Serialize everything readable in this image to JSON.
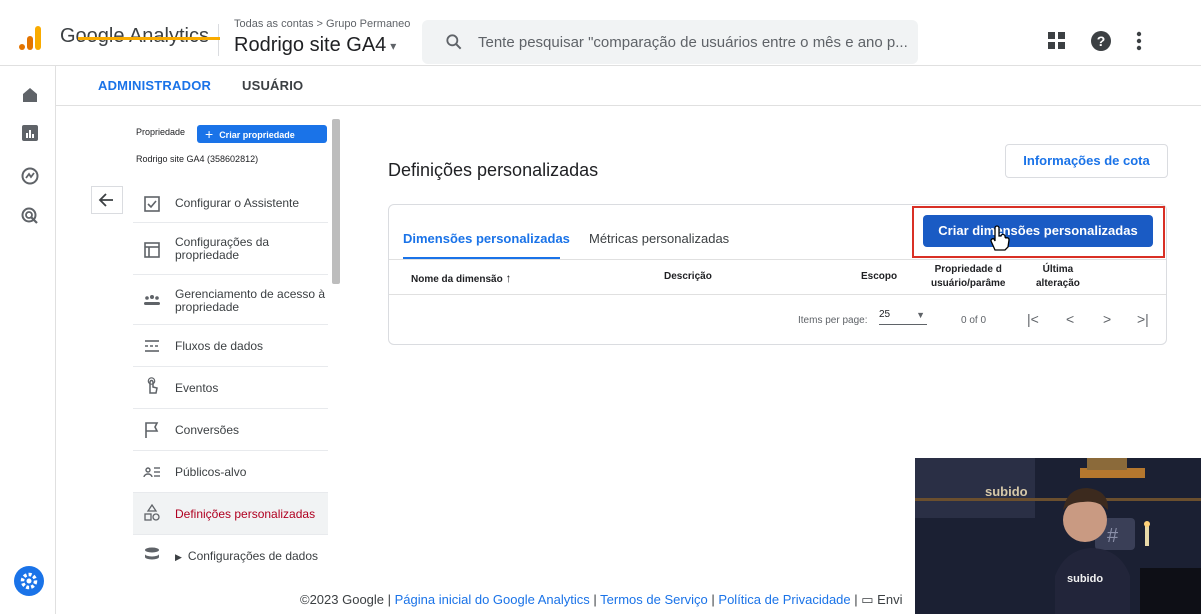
{
  "header": {
    "app_name": "Google Analytics",
    "account_breadcrumb": "Todas as contas > Grupo Permaneo",
    "property_name": "Rodrigo site GA4",
    "search_placeholder": "Tente pesquisar \"comparação de usuários entre o mês e ano p..."
  },
  "tabs": {
    "admin": "ADMINISTRADOR",
    "user": "USUÁRIO"
  },
  "admin_panel": {
    "property_label": "Propriedade",
    "create_property": "Criar propriedade",
    "property_id": "Rodrigo site GA4 (358602812)",
    "items": [
      {
        "label": "Configurar o Assistente",
        "icon": "checkbox-icon"
      },
      {
        "label": "Configurações da propriedade",
        "icon": "property-settings-icon"
      },
      {
        "label": "Gerenciamento de acesso à propriedade",
        "icon": "people-icon"
      },
      {
        "label": "Fluxos de dados",
        "icon": "data-streams-icon"
      },
      {
        "label": "Eventos",
        "icon": "touch-icon"
      },
      {
        "label": "Conversões",
        "icon": "flag-icon"
      },
      {
        "label": "Públicos-alvo",
        "icon": "audience-icon"
      },
      {
        "label": "Definições personalizadas",
        "icon": "shapes-icon"
      },
      {
        "label": "Configurações de dados",
        "icon": "database-icon"
      }
    ]
  },
  "main": {
    "title": "Definições personalizadas",
    "quota_button": "Informações de cota",
    "card": {
      "tab_dimensions": "Dimensões personalizadas",
      "tab_metrics": "Métricas personalizadas",
      "create_button": "Criar dimensões personalizadas",
      "columns": {
        "name": "Nome da dimensão",
        "description": "Descrição",
        "scope": "Escopo",
        "property_1": "Propriedade d",
        "property_2": "usuário/parâme",
        "last_1": "Última",
        "last_2": "alteração"
      },
      "pagination": {
        "items_per_page_label": "Items per page:",
        "items_per_page_value": "25",
        "range": "0 of 0"
      }
    }
  },
  "footer": {
    "copyright": "©2023 Google",
    "sep": " | ",
    "home_link": "Página inicial do Google Analytics",
    "terms_link": "Termos de Serviço",
    "privacy_link": "Política de Privacidade",
    "feedback": "Envi"
  },
  "webcam": {
    "sign_text": "subido",
    "shirt_text": "subido"
  },
  "colors": {
    "accent": "#1a73e8",
    "highlight": "#d93025",
    "ga_orange": "#e37400",
    "active_text": "#b00020"
  }
}
